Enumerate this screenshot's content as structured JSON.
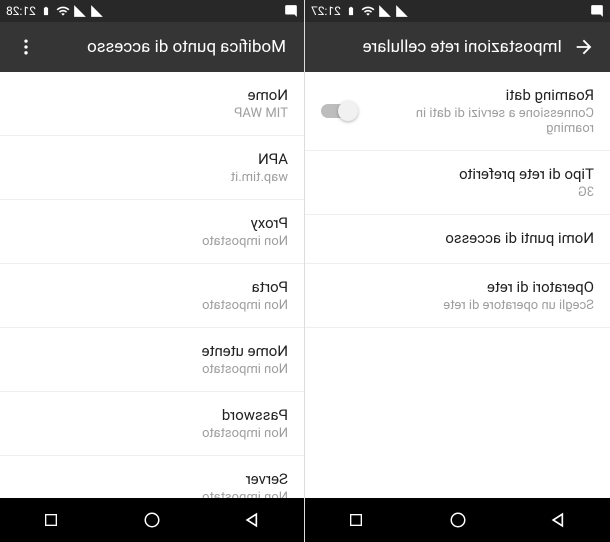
{
  "left": {
    "time": "21:27",
    "header": "Impostazioni rete cellulare",
    "rows": [
      {
        "label": "Roaming dati",
        "sub": "Connessione a servizi di dati in roaming",
        "toggle": true
      },
      {
        "label": "Tipo di rete preferito",
        "sub": "3G"
      },
      {
        "label": "Nomi punti di accesso",
        "sub": ""
      },
      {
        "label": "Operatori di rete",
        "sub": "Scegli un operatore di rete"
      }
    ]
  },
  "right": {
    "time": "21:28",
    "header": "Modifica punto di accesso",
    "rows": [
      {
        "label": "Nome",
        "sub": "TIM WAP"
      },
      {
        "label": "APN",
        "sub": "wap.tim.it"
      },
      {
        "label": "Proxy",
        "sub": "Non impostato"
      },
      {
        "label": "Porta",
        "sub": "Non impostato"
      },
      {
        "label": "Nome utente",
        "sub": "Non impostato"
      },
      {
        "label": "Password",
        "sub": "Non impostato"
      },
      {
        "label": "Server",
        "sub": "Non impostato"
      }
    ]
  }
}
